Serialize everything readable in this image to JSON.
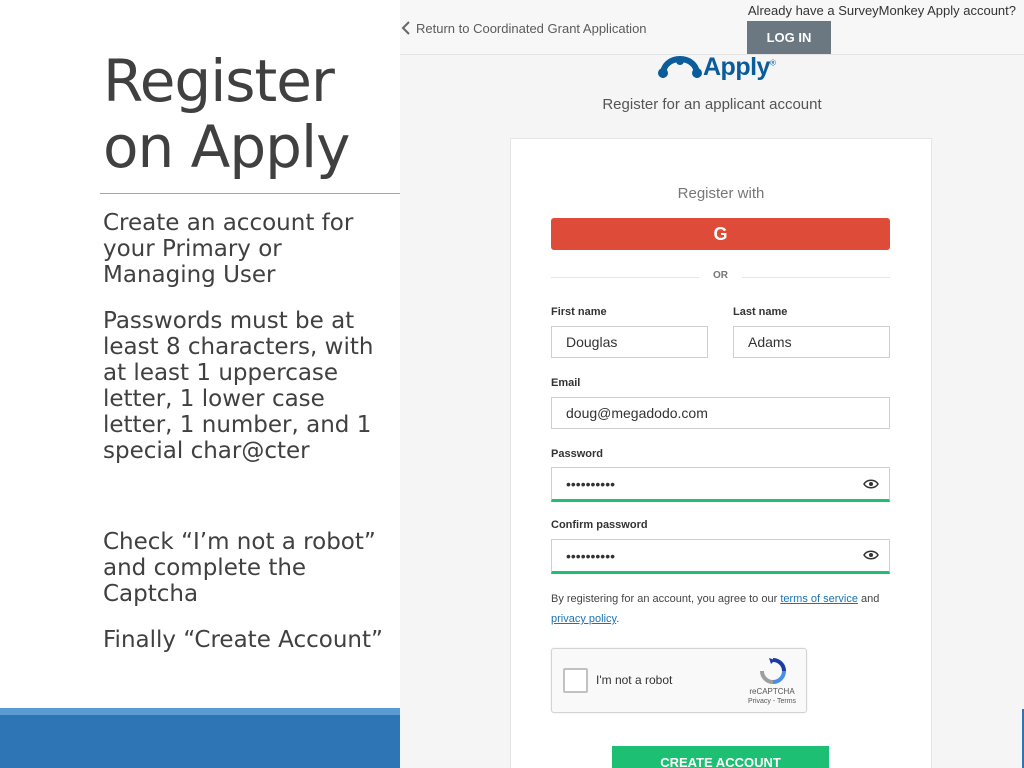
{
  "slide": {
    "title_line1": "Register",
    "title_line2": "on Apply",
    "bullets": [
      "Create an account for your Primary or Managing User",
      "Passwords must be at least 8 characters, with at least 1 uppercase letter, 1 lower case letter, 1 number, and 1 special char@cter",
      "Check “I’m not a robot” and complete the Captcha",
      "Finally “Create Account”"
    ]
  },
  "app": {
    "back_link": "Return to Coordinated Grant Application",
    "already_text": "Already have a SurveyMonkey Apply account?",
    "login_label": "LOG IN",
    "logo_text": "Apply",
    "logo_mark": "®",
    "register_heading": "Register for an applicant account",
    "register_with": "Register with",
    "google_letter": "G",
    "or_label": "OR",
    "fields": {
      "first_name": {
        "label": "First name",
        "value": "Douglas"
      },
      "last_name": {
        "label": "Last name",
        "value": "Adams"
      },
      "email": {
        "label": "Email",
        "value": "doug@megadodo.com"
      },
      "password": {
        "label": "Password",
        "value": "••••••••••"
      },
      "confirm_password": {
        "label": "Confirm password",
        "value": "••••••••••"
      }
    },
    "terms": {
      "prefix": "By registering for an account, you agree to our ",
      "tos": "terms of service",
      "and": " and ",
      "privacy": "privacy policy",
      "suffix": "."
    },
    "captcha": {
      "label": "I'm not a robot",
      "brand": "reCAPTCHA",
      "links": "Privacy - Terms"
    },
    "create_label": "CREATE ACCOUNT"
  },
  "colors": {
    "google_red": "#de4b39",
    "success_green": "#1dbf73",
    "login_gray": "#6b7881",
    "slide_blue": "#2e75b6",
    "logo_blue": "#0a5c9a"
  }
}
